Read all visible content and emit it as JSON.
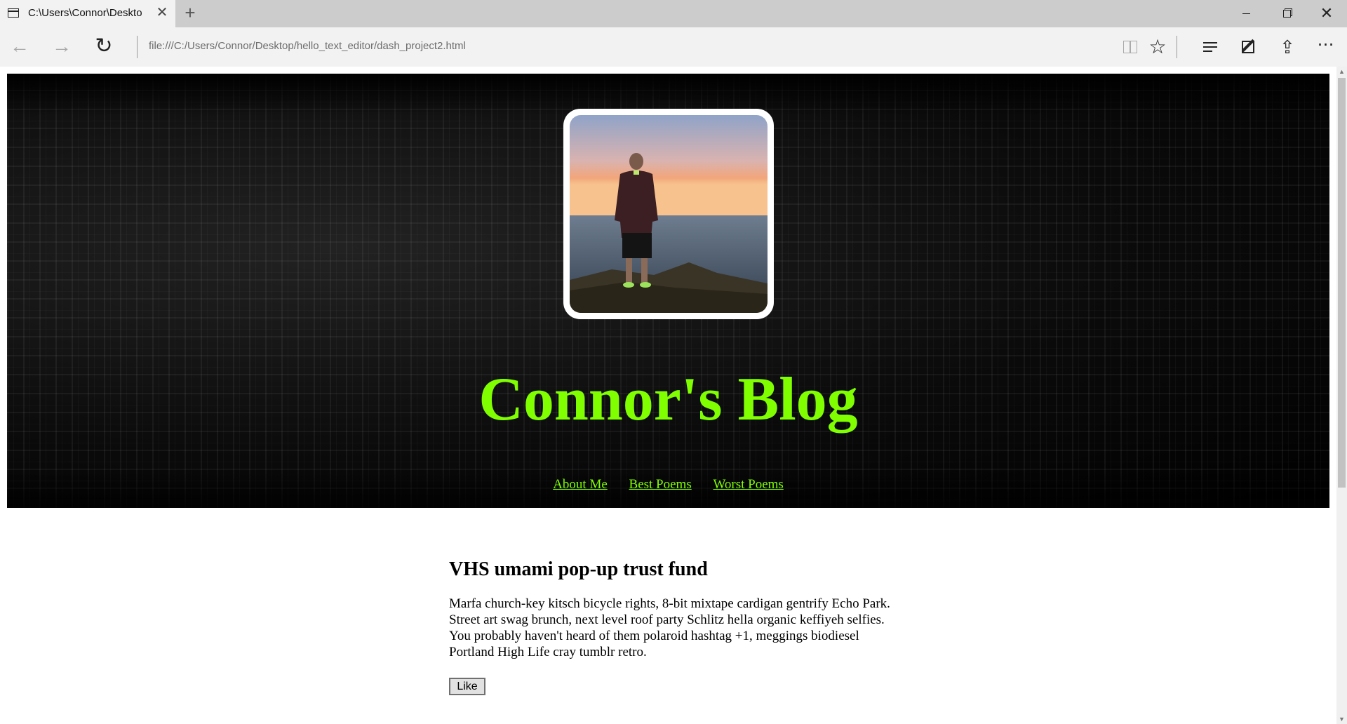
{
  "browser": {
    "tab": {
      "title": "C:\\Users\\Connor\\Deskto",
      "icon": "page-icon",
      "close_icon": "close-icon"
    },
    "new_tab_icon": "plus-icon",
    "window_controls": {
      "minimize_icon": "minimize-icon",
      "restore_icon": "restore-icon",
      "close_icon": "close-icon"
    },
    "address": {
      "url": "file:///C:/Users/Connor/Desktop/hello_text_editor/dash_project2.html"
    },
    "toolbar": [
      "reading-view-icon",
      "favorite-star-icon",
      "hub-icon",
      "web-note-icon",
      "share-icon",
      "more-icon"
    ]
  },
  "hero": {
    "title": "Connor's Blog",
    "title_color": "#7fff00",
    "nav": [
      {
        "label": "About Me"
      },
      {
        "label": "Best Poems"
      },
      {
        "label": "Worst Poems"
      }
    ]
  },
  "post": {
    "heading": "VHS umami pop-up trust fund",
    "body": "Marfa church-key kitsch bicycle rights, 8-bit mixtape cardigan gentrify Echo Park. Street art swag brunch, next level roof party Schlitz hella organic keffiyeh selfies. You probably haven't heard of them polaroid hashtag +1, meggings biodiesel Portland High Life cray tumblr retro.",
    "like_label": "Like"
  }
}
